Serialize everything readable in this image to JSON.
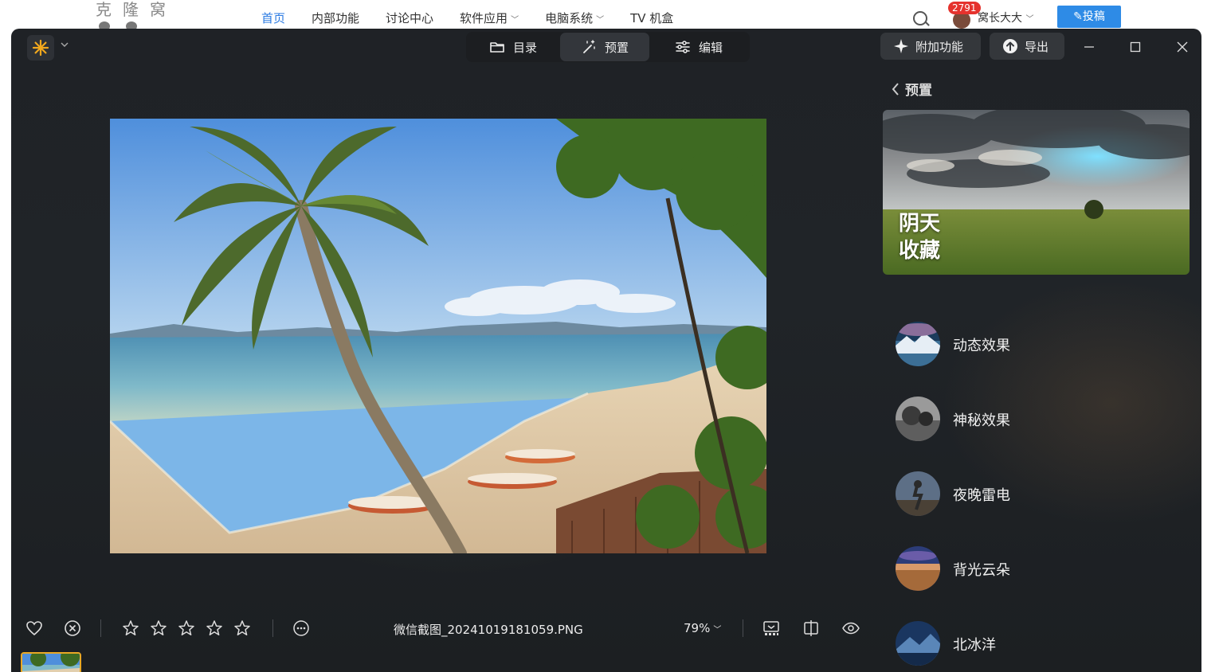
{
  "site": {
    "logo": "克隆窝",
    "nav": [
      {
        "label": "首页",
        "active": true,
        "dropdown": false
      },
      {
        "label": "内部功能",
        "active": false,
        "dropdown": false
      },
      {
        "label": "讨论中心",
        "active": false,
        "dropdown": false
      },
      {
        "label": "软件应用",
        "active": false,
        "dropdown": true
      },
      {
        "label": "电脑系统",
        "active": false,
        "dropdown": true
      },
      {
        "label": "TV 机盒",
        "active": false,
        "dropdown": false
      }
    ],
    "notification_count": "2791",
    "username": "窝长大大",
    "post_button": "✎投稿"
  },
  "app": {
    "modes": [
      {
        "label": "目录",
        "icon": "folder-icon",
        "active": false
      },
      {
        "label": "预置",
        "icon": "magic-wand-icon",
        "active": true
      },
      {
        "label": "编辑",
        "icon": "sliders-icon",
        "active": false
      }
    ],
    "addons_label": "附加功能",
    "export_label": "导出",
    "filename": "微信截图_20241019181059.PNG",
    "zoom": "79%",
    "rating": 0,
    "accent": "#e9a825"
  },
  "panel": {
    "back_label": "预置",
    "featured": {
      "title": "阴天",
      "subtitle": "收藏"
    },
    "presets": [
      {
        "label": "动态效果"
      },
      {
        "label": "神秘效果"
      },
      {
        "label": "夜晚雷电"
      },
      {
        "label": "背光云朵"
      },
      {
        "label": "北冰洋"
      }
    ]
  }
}
